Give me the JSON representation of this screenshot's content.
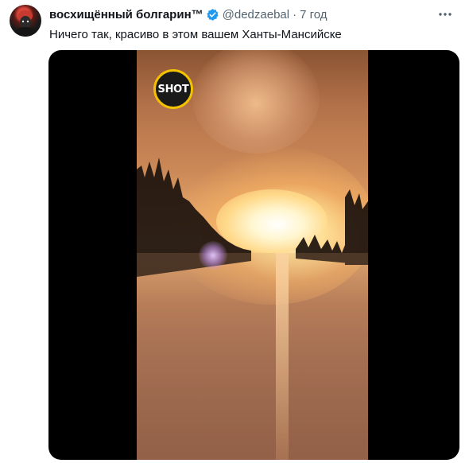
{
  "tweet": {
    "avatar_alt": "avatar",
    "display_name": "восхищённый болгарин™",
    "handle": "@dedzaebal",
    "separator": "·",
    "time": "7 год",
    "text": "Ничего так, красиво в этом вашем Ханты-Мансийске",
    "verified_icon": "verified-badge-icon",
    "more_icon": "more-icon",
    "colors": {
      "text": "#0f1419",
      "secondary": "#536471",
      "verified": "#1d9bf0"
    }
  },
  "media": {
    "type": "video",
    "logo_text": "SHOT"
  }
}
